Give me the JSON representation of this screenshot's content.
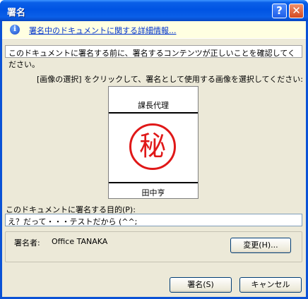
{
  "window": {
    "title": "署名",
    "help_glyph": "?",
    "close_glyph": "✕"
  },
  "infobar": {
    "icon": "info-icon",
    "link_text": "署名中のドキュメントに関する詳細情報..."
  },
  "notice": "このドキュメントに署名する前に、署名するコンテンツが正しいことを確認してください。",
  "instruction": "[画像の選択] をクリックして、署名として使用する画像を選択してください:",
  "signature": {
    "title": "課長代理",
    "seal_char": "秘",
    "name": "田中亨",
    "seal_color": "#e01818"
  },
  "purpose": {
    "label": "このドキュメントに署名する目的(P):",
    "value": "え？だって・・・テストだから (^^;"
  },
  "signer": {
    "label": "署名者:",
    "value": "Office TANAKA",
    "change_button": "変更(H)..."
  },
  "buttons": {
    "sign": "署名(S)",
    "cancel": "キャンセル"
  }
}
